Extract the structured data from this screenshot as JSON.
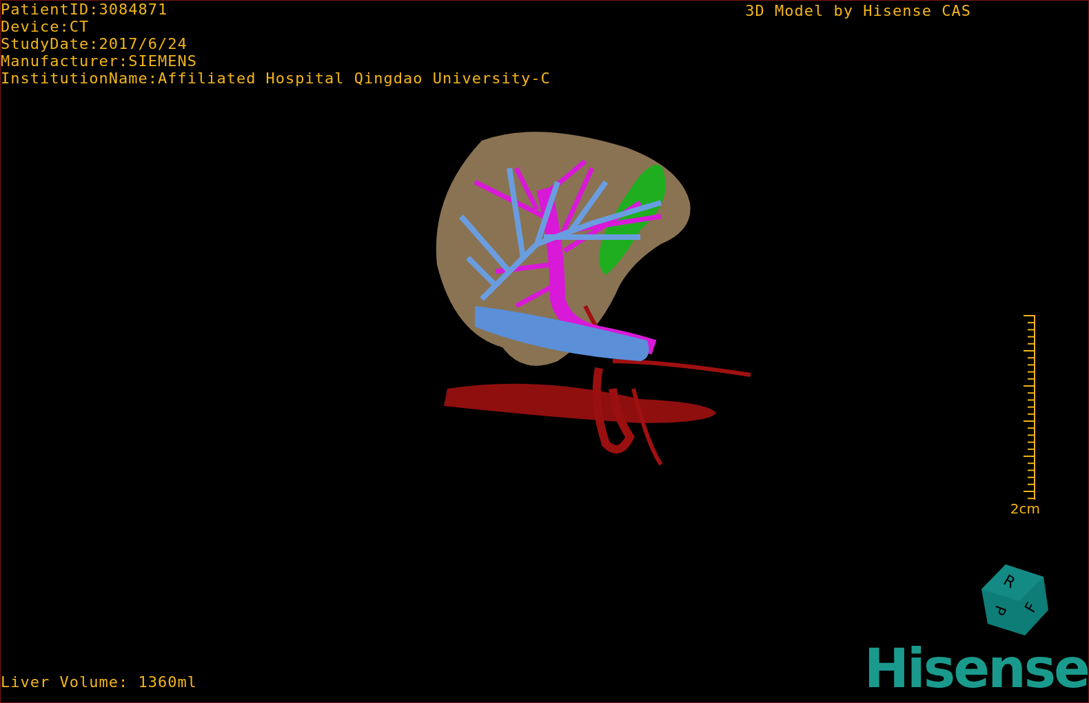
{
  "info_lines": [
    "PatientID:3084871",
    "Device:CT",
    "StudyDate:2017/6/24",
    "Manufacturer:SIEMENS",
    "InstitutionName:Affiliated Hospital Qingdao University-C"
  ],
  "title": "3D Model by Hisense CAS",
  "scale": {
    "label": "2cm"
  },
  "orientation_cube": {
    "faces": [
      "R",
      "F",
      "P"
    ]
  },
  "footer": {
    "volume": "Liver Volume: 1360ml",
    "logo": "Hisense"
  }
}
